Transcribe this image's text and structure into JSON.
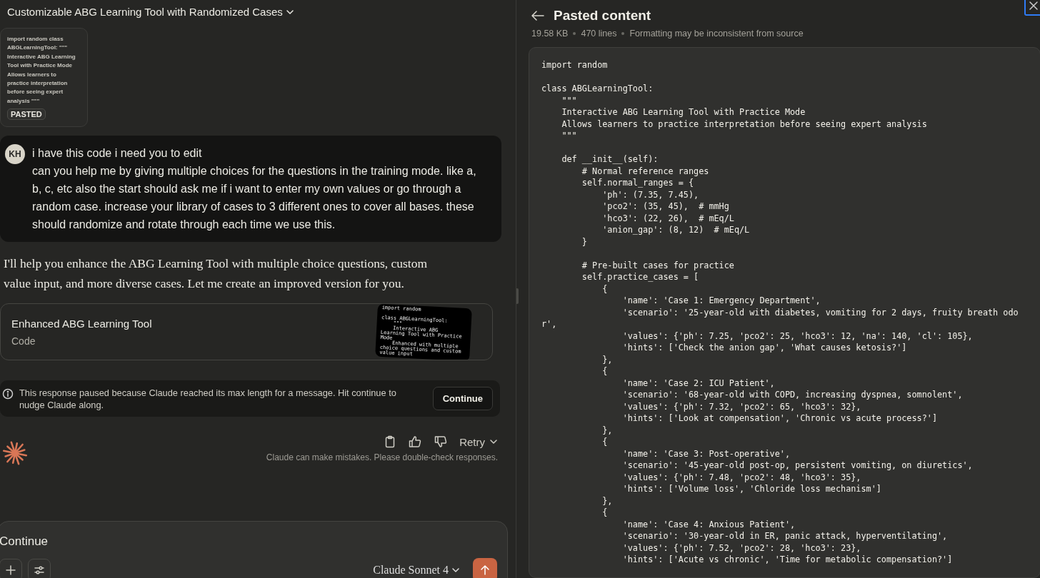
{
  "conversation": {
    "title": "Customizable ABG Learning Tool with Randomized Cases",
    "attachment": {
      "preview": "import random class ABGLearningTool: \"\"\" Interactive ABG Learning Tool with Practice Mode Allows learners to practice interpretation before seeing expert analysis \"\"\"",
      "badge": "PASTED"
    },
    "user_message": {
      "initials": "KH",
      "paragraphs": [
        "i have this code i need you to edit",
        "can you help me by giving multiple choices for the questions in the training mode. like a, b, c, etc also the start should ask me if i want to enter my own values or go through a random case. increase your library of cases to 3 different ones to cover all bases. these should randomize and rotate through each time we use this."
      ]
    },
    "assistant_message": {
      "text": "I'll help you enhance the ABG Learning Tool with multiple choice questions, custom value input, and more diverse cases. Let me create an improved version for you.",
      "artifact": {
        "title": "Enhanced ABG Learning Tool",
        "type": "Code",
        "preview": "import random\n\nclass ABGLearningTool:\n    \"\"\"\n    Interactive ABG\nLearning Tool with Practice\nMode\n    Enhanced with multiple\nchoice questions and custom\nvalue input"
      }
    },
    "notice": {
      "text": "This response paused because Claude reached its max length for a message. Hit continue to nudge Claude along.",
      "button": "Continue"
    },
    "actions": {
      "retry": "Retry",
      "disclaimer": "Claude can make mistakes. Please double-check responses."
    },
    "composer": {
      "value": "Continue",
      "model": "Claude Sonnet 4"
    }
  },
  "pasted_content": {
    "title": "Pasted content",
    "size": "19.58 KB",
    "line_count": "470 lines",
    "note": "Formatting may be inconsistent from source",
    "code": "import random\n\nclass ABGLearningTool:\n    \"\"\"\n    Interactive ABG Learning Tool with Practice Mode\n    Allows learners to practice interpretation before seeing expert analysis\n    \"\"\"\n\n    def __init__(self):\n        # Normal reference ranges\n        self.normal_ranges = {\n            'ph': (7.35, 7.45),\n            'pco2': (35, 45),  # mmHg\n            'hco3': (22, 26),  # mEq/L\n            'anion_gap': (8, 12)  # mEq/L\n        }\n\n        # Pre-built cases for practice\n        self.practice_cases = [\n            {\n                'name': 'Case 1: Emergency Department',\n                'scenario': '25-year-old with diabetes, vomiting for 2 days, fruity breath odo\nr',\n                'values': {'ph': 7.25, 'pco2': 25, 'hco3': 12, 'na': 140, 'cl': 105},\n                'hints': ['Check the anion gap', 'What causes ketosis?']\n            },\n            {\n                'name': 'Case 2: ICU Patient',\n                'scenario': '68-year-old with COPD, increasing dyspnea, somnolent',\n                'values': {'ph': 7.32, 'pco2': 65, 'hco3': 32},\n                'hints': ['Look at compensation', 'Chronic vs acute process?']\n            },\n            {\n                'name': 'Case 3: Post-operative',\n                'scenario': '45-year-old post-op, persistent vomiting, on diuretics',\n                'values': {'ph': 7.48, 'pco2': 48, 'hco3': 35},\n                'hints': ['Volume loss', 'Chloride loss mechanism']\n            },\n            {\n                'name': 'Case 4: Anxious Patient',\n                'scenario': '30-year-old in ER, panic attack, hyperventilating',\n                'values': {'ph': 7.52, 'pco2': 28, 'hco3': 23},\n                'hints': ['Acute vs chronic', 'Time for metabolic compensation?']"
  }
}
